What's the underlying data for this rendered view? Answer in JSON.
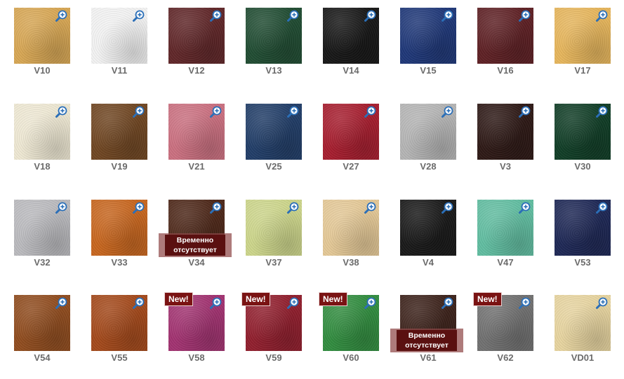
{
  "badge_texts": {
    "new": "New!",
    "out_of_stock": "Временно отсутствует"
  },
  "swatches": [
    {
      "code": "V10",
      "color": "#d6a552"
    },
    {
      "code": "V11",
      "color": "#f1f1f1"
    },
    {
      "code": "V12",
      "color": "#5e2426"
    },
    {
      "code": "V13",
      "color": "#1e4a30"
    },
    {
      "code": "V14",
      "color": "#141414"
    },
    {
      "code": "V15",
      "color": "#1c3576"
    },
    {
      "code": "V16",
      "color": "#5c1e22"
    },
    {
      "code": "V17",
      "color": "#e5b45a"
    },
    {
      "code": "V18",
      "color": "#ede7d2"
    },
    {
      "code": "V19",
      "color": "#6e4420"
    },
    {
      "code": "V21",
      "color": "#c96e7e"
    },
    {
      "code": "V25",
      "color": "#1f3b66"
    },
    {
      "code": "V27",
      "color": "#a51b2c"
    },
    {
      "code": "V28",
      "color": "#b3b3b3"
    },
    {
      "code": "V3",
      "color": "#2b1613"
    },
    {
      "code": "V30",
      "color": "#0e3b24"
    },
    {
      "code": "V32",
      "color": "#b9b9bd"
    },
    {
      "code": "V33",
      "color": "#c6641c"
    },
    {
      "code": "V34",
      "color": "#4b2516",
      "out_of_stock": true
    },
    {
      "code": "V37",
      "color": "#cbd489"
    },
    {
      "code": "V38",
      "color": "#e3c795"
    },
    {
      "code": "V4",
      "color": "#161616"
    },
    {
      "code": "V47",
      "color": "#5fbc9f"
    },
    {
      "code": "V53",
      "color": "#1b2553"
    },
    {
      "code": "V54",
      "color": "#8e4a1c"
    },
    {
      "code": "V55",
      "color": "#a24718"
    },
    {
      "code": "V58",
      "color": "#a0306f",
      "new": true
    },
    {
      "code": "V59",
      "color": "#8f1c2b",
      "new": true
    },
    {
      "code": "V60",
      "color": "#2f8b3d",
      "new": true
    },
    {
      "code": "V61",
      "color": "#3a2018",
      "out_of_stock": true
    },
    {
      "code": "V62",
      "color": "#6f6f6f",
      "new": true
    },
    {
      "code": "VD01",
      "color": "#e6d39e"
    }
  ]
}
